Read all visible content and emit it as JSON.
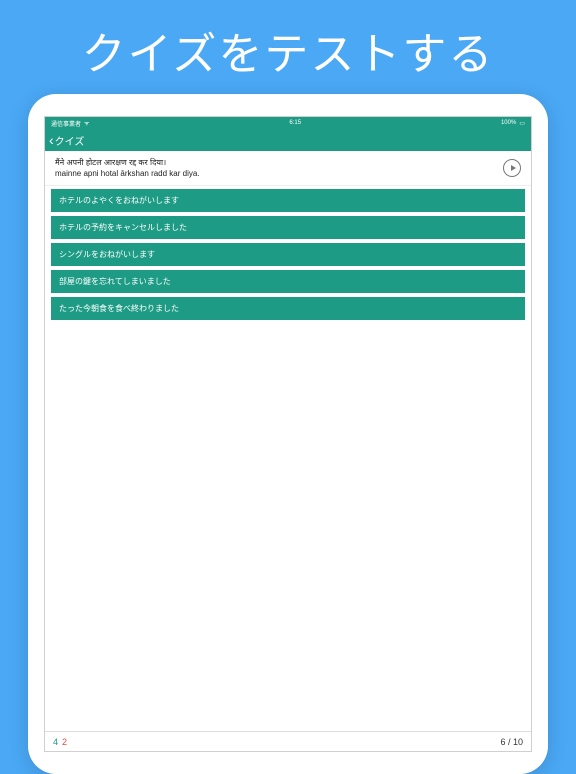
{
  "hero": {
    "title": "クイズをテストする"
  },
  "statusBar": {
    "carrier": "通信事業者",
    "wifi": "📶",
    "time": "6:15",
    "battery": "100%"
  },
  "nav": {
    "backLabel": "クイズ"
  },
  "question": {
    "hindi": "मैंने अपनी होटल आरक्षण रद्द कर दिया।",
    "romanized": "mainne apni hotal ārkshan radd kar diya."
  },
  "answers": [
    "ホテルのよやくをおねがいします",
    "ホテルの予約をキャンセルしました",
    "シングルをおねがいします",
    "部屋の鍵を忘れてしまいました",
    "たった今朝食を食べ終わりました"
  ],
  "score": {
    "correct": "4",
    "wrong": "2"
  },
  "progress": "6 / 10"
}
